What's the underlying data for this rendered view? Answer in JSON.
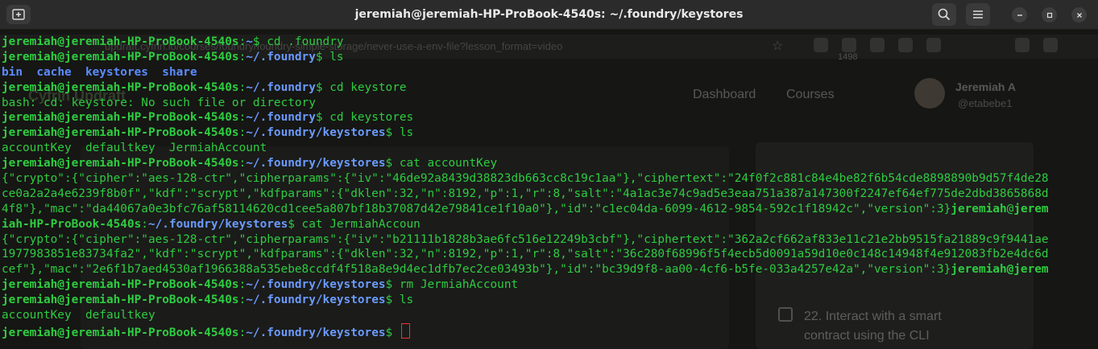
{
  "window": {
    "title": "jeremiah@jeremiah-HP-ProBook-4540s: ~/.foundry/keystores",
    "new_tab_icon": "new-tab-icon",
    "search_icon": "search-icon",
    "menu_icon": "hamburger-menu-icon"
  },
  "colors": {
    "prompt_user": "#2ecc40",
    "prompt_path": "#6a9bff",
    "directory": "#5b8cff",
    "output": "#2ecc40",
    "cursor": "#ee3333"
  },
  "background_browser": {
    "url": "updraft.cyfrin.io/courses/foundry/foundry-simple-storage/never-use-a-env-file?lesson_format=video",
    "badge": "1498",
    "nav": [
      "Dashboard",
      "Courses"
    ],
    "user_name": "Jeremiah A",
    "user_handle": "@etabebe1",
    "lesson_title": "22. Interact with a smart contract using the CLI",
    "logo": "Cyfrin Updraft"
  },
  "terminal": {
    "lines": [
      [
        {
          "t": "jeremiah@jeremiah-HP-ProBook-4540s",
          "c": "user"
        },
        {
          "t": ":",
          "c": "txt"
        },
        {
          "t": "~",
          "c": "path"
        },
        {
          "t": "$ cd .foundry",
          "c": "txt"
        }
      ],
      [
        {
          "t": "jeremiah@jeremiah-HP-ProBook-4540s",
          "c": "user"
        },
        {
          "t": ":",
          "c": "txt"
        },
        {
          "t": "~/.foundry",
          "c": "path"
        },
        {
          "t": "$ ls",
          "c": "txt"
        }
      ],
      [
        {
          "t": "bin",
          "c": "dir"
        },
        {
          "t": "  ",
          "c": "txt"
        },
        {
          "t": "cache",
          "c": "dir"
        },
        {
          "t": "  ",
          "c": "txt"
        },
        {
          "t": "keystores",
          "c": "dir"
        },
        {
          "t": "  ",
          "c": "txt"
        },
        {
          "t": "share",
          "c": "dir"
        }
      ],
      [
        {
          "t": "jeremiah@jeremiah-HP-ProBook-4540s",
          "c": "user"
        },
        {
          "t": ":",
          "c": "txt"
        },
        {
          "t": "~/.foundry",
          "c": "path"
        },
        {
          "t": "$ cd keystore",
          "c": "txt"
        }
      ],
      [
        {
          "t": "bash: cd: keystore: No such file or directory",
          "c": "txt"
        }
      ],
      [
        {
          "t": "jeremiah@jeremiah-HP-ProBook-4540s",
          "c": "user"
        },
        {
          "t": ":",
          "c": "txt"
        },
        {
          "t": "~/.foundry",
          "c": "path"
        },
        {
          "t": "$ cd keystores",
          "c": "txt"
        }
      ],
      [
        {
          "t": "jeremiah@jeremiah-HP-ProBook-4540s",
          "c": "user"
        },
        {
          "t": ":",
          "c": "txt"
        },
        {
          "t": "~/.foundry/keystores",
          "c": "path"
        },
        {
          "t": "$ ls",
          "c": "txt"
        }
      ],
      [
        {
          "t": "accountKey  defaultkey  JermiahAccount",
          "c": "txt"
        }
      ],
      [
        {
          "t": "jeremiah@jeremiah-HP-ProBook-4540s",
          "c": "user"
        },
        {
          "t": ":",
          "c": "txt"
        },
        {
          "t": "~/.foundry/keystores",
          "c": "path"
        },
        {
          "t": "$ cat accountKey",
          "c": "txt"
        }
      ],
      [
        {
          "t": "{\"crypto\":{\"cipher\":\"aes-128-ctr\",\"cipherparams\":{\"iv\":\"46de92a8439d38823db663cc8c19c1aa\"},\"ciphertext\":\"24f0f2c881c84e4be82f6b54cde8898890b9d57f4de28",
          "c": "txt"
        }
      ],
      [
        {
          "t": "ce0a2a2a4e6239f8b0f\",\"kdf\":\"scrypt\",\"kdfparams\":{\"dklen\":32,\"n\":8192,\"p\":1,\"r\":8,\"salt\":\"4a1ac3e74c9ad5e3eaa751a387a147300f2247ef64ef775de2dbd3865868d",
          "c": "txt"
        }
      ],
      [
        {
          "t": "4f8\"},\"mac\":\"da44067a0e3bfc76af58114620cd1cee5a807bf18b37087d42e79841ce1f10a0\"},\"id\":\"c1ec04da-6099-4612-9854-592c1f18942c\",\"version\":3}",
          "c": "txt"
        },
        {
          "t": "jeremiah",
          "c": "user"
        },
        {
          "t": "@",
          "c": "txt"
        },
        {
          "t": "jerem",
          "c": "user"
        }
      ],
      [
        {
          "t": "iah-HP-ProBook-4540s",
          "c": "user"
        },
        {
          "t": ":",
          "c": "txt"
        },
        {
          "t": "~/.foundry/keystores",
          "c": "path"
        },
        {
          "t": "$ cat JermiahAccoun",
          "c": "txt"
        }
      ],
      [
        {
          "t": "{\"crypto\":{\"cipher\":\"aes-128-ctr\",\"cipherparams\":{\"iv\":\"b21111b1828b3ae6fc516e12249b3cbf\"},\"ciphertext\":\"362a2cf662af833e11c21e2bb9515fa21889c9f9441ae",
          "c": "txt"
        }
      ],
      [
        {
          "t": "1977983851e83734fa2\",\"kdf\":\"scrypt\",\"kdfparams\":{\"dklen\":32,\"n\":8192,\"p\":1,\"r\":8,\"salt\":\"36c280f68996f5f4ecb5d0091a59d10e0c148c14948f4e912083fb2e4dc6d",
          "c": "txt"
        }
      ],
      [
        {
          "t": "cef\"},\"mac\":\"2e6f1b7aed4530af1966388a535ebe8ccdf4f518a8e9d4ec1dfb7ec2ce03493b\"},\"id\":\"bc39d9f8-aa00-4cf6-b5fe-033a4257e42a\",\"version\":3}",
          "c": "txt"
        },
        {
          "t": "jeremiah@jerem",
          "c": "user"
        }
      ],
      [
        {
          "t": "jeremiah@jeremiah-HP-ProBook-4540s",
          "c": "user"
        },
        {
          "t": ":",
          "c": "txt"
        },
        {
          "t": "~/.foundry/keystores",
          "c": "path"
        },
        {
          "t": "$ rm JermiahAccount",
          "c": "txt"
        }
      ],
      [
        {
          "t": "jeremiah@jeremiah-HP-ProBook-4540s",
          "c": "user"
        },
        {
          "t": ":",
          "c": "txt"
        },
        {
          "t": "~/.foundry/keystores",
          "c": "path"
        },
        {
          "t": "$ ls",
          "c": "txt"
        }
      ],
      [
        {
          "t": "accountKey  defaultkey",
          "c": "txt"
        }
      ],
      [
        {
          "t": "jeremiah@jeremiah-HP-ProBook-4540s",
          "c": "user"
        },
        {
          "t": ":",
          "c": "txt"
        },
        {
          "t": "~/.foundry/keystores",
          "c": "path"
        },
        {
          "t": "$ ",
          "c": "txt"
        }
      ]
    ]
  }
}
